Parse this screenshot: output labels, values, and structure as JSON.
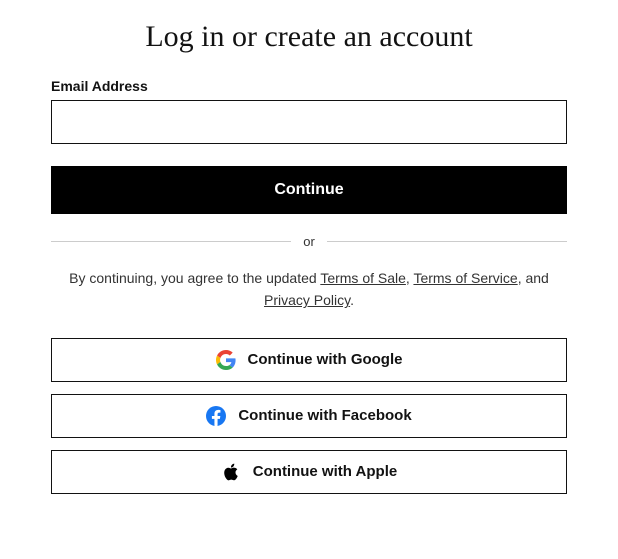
{
  "title": "Log in or create an account",
  "email": {
    "label": "Email Address",
    "value": ""
  },
  "continue_label": "Continue",
  "divider_text": "or",
  "terms": {
    "prefix": "By continuing, you agree to the updated ",
    "link1": "Terms of Sale",
    "sep1": ", ",
    "link2": "Terms of Service",
    "sep2": ", and ",
    "link3": "Privacy Policy",
    "suffix": "."
  },
  "social": {
    "google_label": "Continue with Google",
    "facebook_label": "Continue with Facebook",
    "apple_label": "Continue with Apple"
  },
  "icons": {
    "google": "google-icon",
    "facebook": "facebook-icon",
    "apple": "apple-icon"
  },
  "colors": {
    "primary_button_bg": "#000000",
    "primary_button_text": "#ffffff",
    "border": "#121212",
    "facebook": "#1877f2"
  }
}
